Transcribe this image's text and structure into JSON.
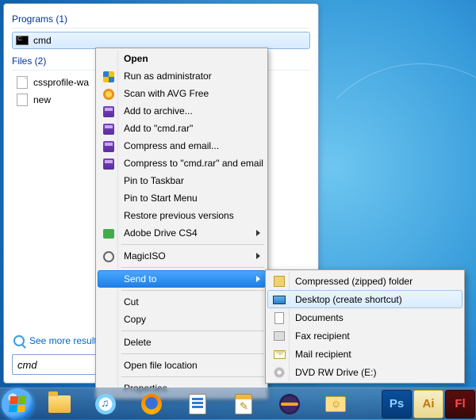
{
  "search_panel": {
    "programs_header": "Programs (1)",
    "files_header": "Files (2)",
    "program_result": "cmd",
    "file_results": [
      "cssprofile-wa",
      "new"
    ],
    "see_more": "See more results",
    "search_value": "cmd"
  },
  "context_menu": {
    "items": [
      {
        "label": "Open",
        "bold": true
      },
      {
        "label": "Run as administrator",
        "icon": "shield"
      },
      {
        "label": "Scan with AVG Free",
        "icon": "avg"
      },
      {
        "label": "Add to archive...",
        "icon": "rar"
      },
      {
        "label": "Add to \"cmd.rar\"",
        "icon": "rar"
      },
      {
        "label": "Compress and email...",
        "icon": "rar"
      },
      {
        "label": "Compress to \"cmd.rar\" and email",
        "icon": "rar"
      },
      {
        "label": "Pin to Taskbar"
      },
      {
        "label": "Pin to Start Menu"
      },
      {
        "label": "Restore previous versions"
      },
      {
        "label": "Adobe Drive CS4",
        "icon": "drive",
        "submenu": true
      },
      {
        "sep": true
      },
      {
        "label": "MagicISO",
        "icon": "magiciso",
        "submenu": true
      },
      {
        "sep": true
      },
      {
        "label": "Send to",
        "submenu": true,
        "highlight": true
      },
      {
        "sep": true
      },
      {
        "label": "Cut"
      },
      {
        "label": "Copy"
      },
      {
        "sep": true
      },
      {
        "label": "Delete"
      },
      {
        "sep": true
      },
      {
        "label": "Open file location"
      },
      {
        "sep": true
      },
      {
        "label": "Properties"
      }
    ]
  },
  "sendto_submenu": {
    "items": [
      {
        "label": "Compressed (zipped) folder",
        "icon": "zip"
      },
      {
        "label": "Desktop (create shortcut)",
        "icon": "desktop",
        "highlight": true
      },
      {
        "label": "Documents",
        "icon": "doc"
      },
      {
        "label": "Fax recipient",
        "icon": "fax"
      },
      {
        "label": "Mail recipient",
        "icon": "mail"
      },
      {
        "label": "DVD RW Drive (E:)",
        "icon": "dvd"
      }
    ]
  },
  "taskbar": {
    "apps": [
      "explorer",
      "itunes",
      "firefox",
      "screenpresso",
      "notepad",
      "eclipse",
      "cyberduck"
    ],
    "adobe": [
      {
        "code": "Ps",
        "class": "ps"
      },
      {
        "code": "Ai",
        "class": "ai"
      },
      {
        "code": "Fl",
        "class": "fl"
      }
    ]
  }
}
